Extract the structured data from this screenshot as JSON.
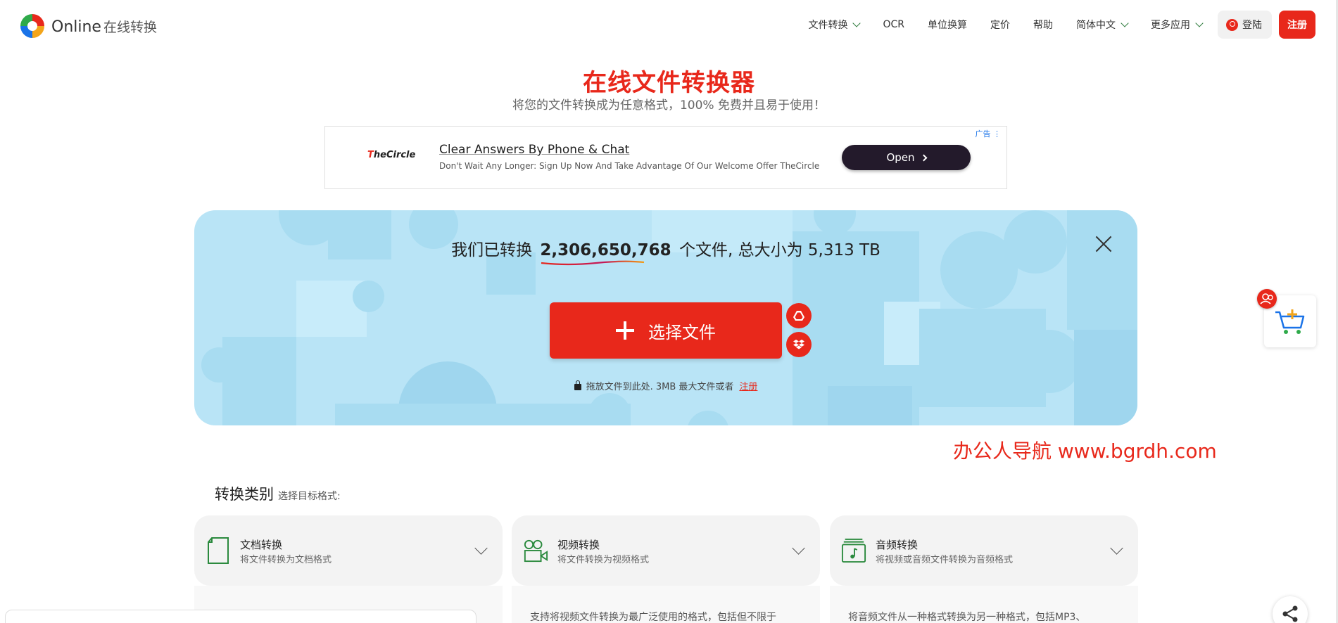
{
  "brand": {
    "name": "Online",
    "name_cn": "在线转换"
  },
  "nav": {
    "items": [
      {
        "label": "文件转换",
        "dropdown": true
      },
      {
        "label": "OCR",
        "dropdown": false
      },
      {
        "label": "单位换算",
        "dropdown": false
      },
      {
        "label": "定价",
        "dropdown": false
      },
      {
        "label": "帮助",
        "dropdown": false
      },
      {
        "label": "简体中文",
        "dropdown": true
      },
      {
        "label": "更多应用",
        "dropdown": true
      }
    ],
    "login_label": "登陆",
    "register_label": "注册"
  },
  "hero": {
    "title": "在线文件转换器",
    "subtitle": "将您的文件转换成为任意格式，100% 免费并且易于使用！"
  },
  "ad": {
    "tag": "广告 ⋮",
    "brand": "TheCircle",
    "headline": "Clear Answers By Phone & Chat",
    "description": "Don't Wait Any Longer: Sign Up Now And Take Advantage Of Our Welcome Offer TheCircle",
    "cta": "Open"
  },
  "upload": {
    "stats_prefix": "我们已转换",
    "files_count": "2,306,650,768",
    "stats_suffix": "个文件, 总大小为 5,313 TB",
    "choose_label": "选择文件",
    "drop_note": "拖放文件到此处. 3MB 最大文件或者",
    "register_link": "注册"
  },
  "watermark": "办公人导航  www.bgrdh.com",
  "categories": {
    "title": "转换类别",
    "hint": "选择目标格式:",
    "cards": [
      {
        "title": "文档转换",
        "desc": "将文件转换为文档格式",
        "body": ""
      },
      {
        "title": "视频转换",
        "desc": "将文件转换为视频格式",
        "body": "支持将视频文件转换为最广泛使用的格式，包括但不限于"
      },
      {
        "title": "音频转换",
        "desc": "将视频或音频文件转换为音频格式",
        "body": "将音频文件从一种格式转换为另一种格式，包括MP3、"
      }
    ]
  },
  "colors": {
    "accent": "#e8281b",
    "panel": "#b9e4f6",
    "nav_chevron": "#2b7a3a"
  },
  "icons": [
    "google-drive-icon",
    "dropbox-icon",
    "lock-icon",
    "close-icon",
    "plus-icon",
    "cart-icon",
    "share-icon",
    "user-icon",
    "document-icon",
    "video-icon",
    "audio-icon"
  ]
}
